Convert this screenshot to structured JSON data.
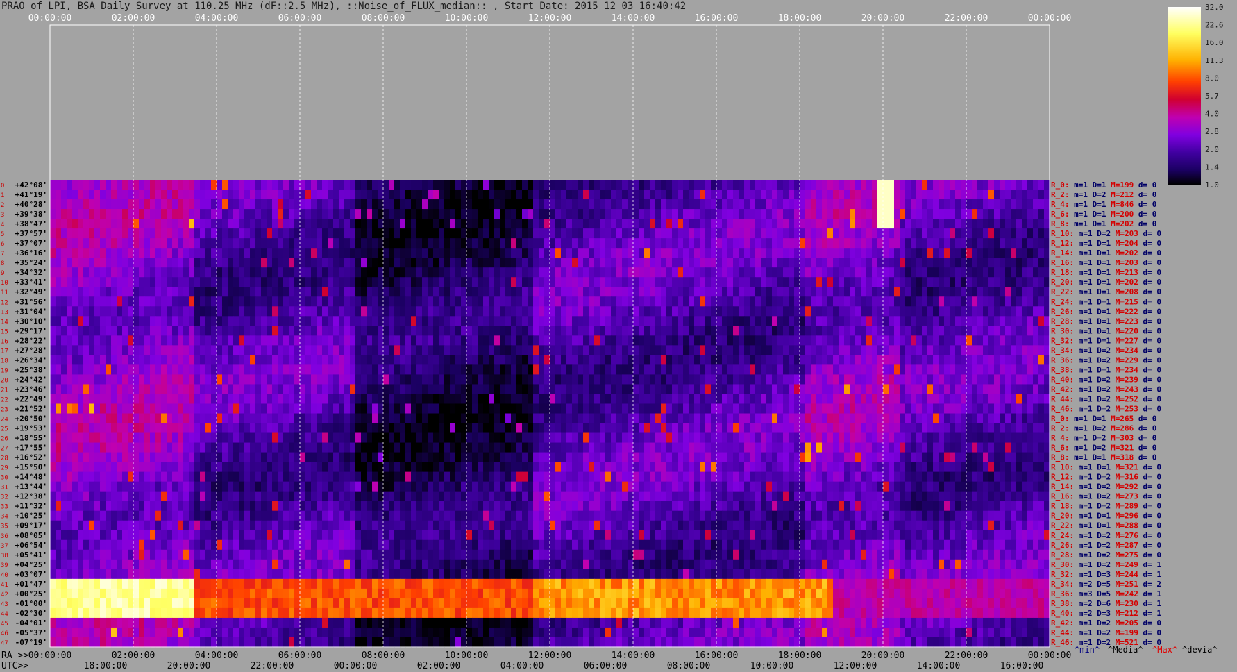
{
  "title": "PRAO of LPI, BSA Daily Survey at 110.25 MHz (dF::2.5 MHz), ::Noise_of_FLUX_median:: , Start Date: 2015 12 03 16:40:42",
  "chart_data": {
    "type": "heatmap",
    "title": "PRAO of LPI, BSA Daily Survey at 110.25 MHz (dF::2.5 MHz), ::Noise_of_FLUX_median:: , Start Date: 2015 12 03 16:40:42",
    "x_axis_top_label": "",
    "utc_ticks": [
      "00:00:00",
      "02:00:00",
      "04:00:00",
      "06:00:00",
      "08:00:00",
      "10:00:00",
      "12:00:00",
      "14:00:00",
      "16:00:00",
      "18:00:00",
      "20:00:00",
      "22:00:00",
      "00:00:00"
    ],
    "ra_prefix": "RA >>",
    "ra_ticks": [
      "00:00:00",
      "02:00:00",
      "04:00:00",
      "06:00:00",
      "08:00:00",
      "10:00:00",
      "12:00:00",
      "14:00:00",
      "16:00:00",
      "18:00:00",
      "20:00:00",
      "22:00:00",
      "00:00:00"
    ],
    "utc_prefix": "UTC>>",
    "utc_bottom_ticks": [
      "18:00:00",
      "20:00:00",
      "22:00:00",
      "00:00:00",
      "02:00:00",
      "04:00:00",
      "06:00:00",
      "08:00:00",
      "10:00:00",
      "12:00:00",
      "14:00:00",
      "16:00:00"
    ],
    "declinations": [
      "+42°08'",
      "+41°19'",
      "+40°28'",
      "+39°38'",
      "+38°47'",
      "+37°57'",
      "+37°07'",
      "+36°16'",
      "+35°24'",
      "+34°32'",
      "+33°41'",
      "+32°49'",
      "+31°56'",
      "+31°04'",
      "+30°10'",
      "+29°17'",
      "+28°22'",
      "+27°28'",
      "+26°34'",
      "+25°38'",
      "+24°42'",
      "+23°46'",
      "+22°49'",
      "+21°52'",
      "+20°50'",
      "+19°53'",
      "+18°55'",
      "+17°55'",
      "+16°52'",
      "+15°50'",
      "+14°48'",
      "+13°44'",
      "+12°38'",
      "+11°32'",
      "+10°25'",
      "+09°17'",
      "+08°05'",
      "+06°54'",
      "+05°41'",
      "+04°25'",
      "+03°07'",
      "+01°47'",
      "+00°25'",
      "-01°00'",
      "-02°30'",
      "-04°01'",
      "-05°37'",
      "-07°19'"
    ],
    "colorbar": {
      "ticks": [
        "32.0",
        "22.6",
        "16.0",
        "11.3",
        "8.0",
        "5.7",
        "4.0",
        "2.8",
        "2.0",
        "1.4",
        "1.0"
      ],
      "scale": "log",
      "range": [
        1.0,
        32.0
      ]
    },
    "stats_rows": [
      {
        "r": "R_0:",
        "m": "m=1",
        "D": "D=1",
        "M": "M=199",
        "d": "d= 0"
      },
      {
        "r": "R_2:",
        "m": "m=1",
        "D": "D=2",
        "M": "M=212",
        "d": "d= 0"
      },
      {
        "r": "R_4:",
        "m": "m=1",
        "D": "D=1",
        "M": "M=846",
        "d": "d= 0"
      },
      {
        "r": "R_6:",
        "m": "m=1",
        "D": "D=1",
        "M": "M=200",
        "d": "d= 0"
      },
      {
        "r": "R_8:",
        "m": "m=1",
        "D": "D=1",
        "M": "M=202",
        "d": "d= 0"
      },
      {
        "r": "R_10:",
        "m": "m=1",
        "D": "D=2",
        "M": "M=203",
        "d": "d= 0"
      },
      {
        "r": "R_12:",
        "m": "m=1",
        "D": "D=1",
        "M": "M=204",
        "d": "d= 0"
      },
      {
        "r": "R_14:",
        "m": "m=1",
        "D": "D=1",
        "M": "M=202",
        "d": "d= 0"
      },
      {
        "r": "R_16:",
        "m": "m=1",
        "D": "D=1",
        "M": "M=203",
        "d": "d= 0"
      },
      {
        "r": "R_18:",
        "m": "m=1",
        "D": "D=1",
        "M": "M=213",
        "d": "d= 0"
      },
      {
        "r": "R_20:",
        "m": "m=1",
        "D": "D=1",
        "M": "M=202",
        "d": "d= 0"
      },
      {
        "r": "R_22:",
        "m": "m=1",
        "D": "D=1",
        "M": "M=208",
        "d": "d= 0"
      },
      {
        "r": "R_24:",
        "m": "m=1",
        "D": "D=1",
        "M": "M=215",
        "d": "d= 0"
      },
      {
        "r": "R_26:",
        "m": "m=1",
        "D": "D=1",
        "M": "M=222",
        "d": "d= 0"
      },
      {
        "r": "R_28:",
        "m": "m=1",
        "D": "D=1",
        "M": "M=223",
        "d": "d= 0"
      },
      {
        "r": "R_30:",
        "m": "m=1",
        "D": "D=1",
        "M": "M=220",
        "d": "d= 0"
      },
      {
        "r": "R_32:",
        "m": "m=1",
        "D": "D=1",
        "M": "M=227",
        "d": "d= 0"
      },
      {
        "r": "R_34:",
        "m": "m=1",
        "D": "D=2",
        "M": "M=234",
        "d": "d= 0"
      },
      {
        "r": "R_36:",
        "m": "m=1",
        "D": "D=2",
        "M": "M=229",
        "d": "d= 0"
      },
      {
        "r": "R_38:",
        "m": "m=1",
        "D": "D=1",
        "M": "M=234",
        "d": "d= 0"
      },
      {
        "r": "R_40:",
        "m": "m=1",
        "D": "D=2",
        "M": "M=239",
        "d": "d= 0"
      },
      {
        "r": "R_42:",
        "m": "m=1",
        "D": "D=2",
        "M": "M=243",
        "d": "d= 0"
      },
      {
        "r": "R_44:",
        "m": "m=1",
        "D": "D=2",
        "M": "M=252",
        "d": "d= 0"
      },
      {
        "r": "R_46:",
        "m": "m=1",
        "D": "D=2",
        "M": "M=253",
        "d": "d= 0"
      },
      {
        "r": "R_0:",
        "m": "m=1",
        "D": "D=1",
        "M": "M=265",
        "d": "d= 0"
      },
      {
        "r": "R_2:",
        "m": "m=1",
        "D": "D=2",
        "M": "M=286",
        "d": "d= 0"
      },
      {
        "r": "R_4:",
        "m": "m=1",
        "D": "D=2",
        "M": "M=303",
        "d": "d= 0"
      },
      {
        "r": "R_6:",
        "m": "m=1",
        "D": "D=2",
        "M": "M=321",
        "d": "d= 0"
      },
      {
        "r": "R_8:",
        "m": "m=1",
        "D": "D=1",
        "M": "M=318",
        "d": "d= 0"
      },
      {
        "r": "R_10:",
        "m": "m=1",
        "D": "D=1",
        "M": "M=321",
        "d": "d= 0"
      },
      {
        "r": "R_12:",
        "m": "m=1",
        "D": "D=2",
        "M": "M=316",
        "d": "d= 0"
      },
      {
        "r": "R_14:",
        "m": "m=1",
        "D": "D=2",
        "M": "M=292",
        "d": "d= 0"
      },
      {
        "r": "R_16:",
        "m": "m=1",
        "D": "D=2",
        "M": "M=273",
        "d": "d= 0"
      },
      {
        "r": "R_18:",
        "m": "m=1",
        "D": "D=2",
        "M": "M=289",
        "d": "d= 0"
      },
      {
        "r": "R_20:",
        "m": "m=1",
        "D": "D=1",
        "M": "M=296",
        "d": "d= 0"
      },
      {
        "r": "R_22:",
        "m": "m=1",
        "D": "D=1",
        "M": "M=288",
        "d": "d= 0"
      },
      {
        "r": "R_24:",
        "m": "m=1",
        "D": "D=2",
        "M": "M=276",
        "d": "d= 0"
      },
      {
        "r": "R_26:",
        "m": "m=1",
        "D": "D=2",
        "M": "M=287",
        "d": "d= 0"
      },
      {
        "r": "R_28:",
        "m": "m=1",
        "D": "D=2",
        "M": "M=275",
        "d": "d= 0"
      },
      {
        "r": "R_30:",
        "m": "m=1",
        "D": "D=2",
        "M": "M=249",
        "d": "d= 1"
      },
      {
        "r": "R_32:",
        "m": "m=1",
        "D": "D=3",
        "M": "M=244",
        "d": "d= 1"
      },
      {
        "r": "R_34:",
        "m": "m=2",
        "D": "D=5",
        "M": "M=251",
        "d": "d= 2"
      },
      {
        "r": "R_36:",
        "m": "m=3",
        "D": "D=5",
        "M": "M=242",
        "d": "d= 1"
      },
      {
        "r": "R_38:",
        "m": "m=2",
        "D": "D=6",
        "M": "M=230",
        "d": "d= 1"
      },
      {
        "r": "R_40:",
        "m": "m=2",
        "D": "D=3",
        "M": "M=212",
        "d": "d= 1"
      },
      {
        "r": "R_42:",
        "m": "m=1",
        "D": "D=2",
        "M": "M=205",
        "d": "d= 0"
      },
      {
        "r": "R_44:",
        "m": "m=1",
        "D": "D=2",
        "M": "M=199",
        "d": "d= 0"
      },
      {
        "r": "R_46:",
        "m": "m=1",
        "D": "D=2",
        "M": "M=521",
        "d": "d= 0"
      }
    ],
    "legend": {
      "min": "^min^",
      "media": "^Media^",
      "max": "^Max^",
      "devia": "^devia^"
    },
    "hot_band_decs": [
      "+01°47'",
      "+00°25'",
      "-01°00'",
      "-02°30'"
    ],
    "bright_source_ra": "20:00:00",
    "bright_source_dec": "+40°28'"
  }
}
